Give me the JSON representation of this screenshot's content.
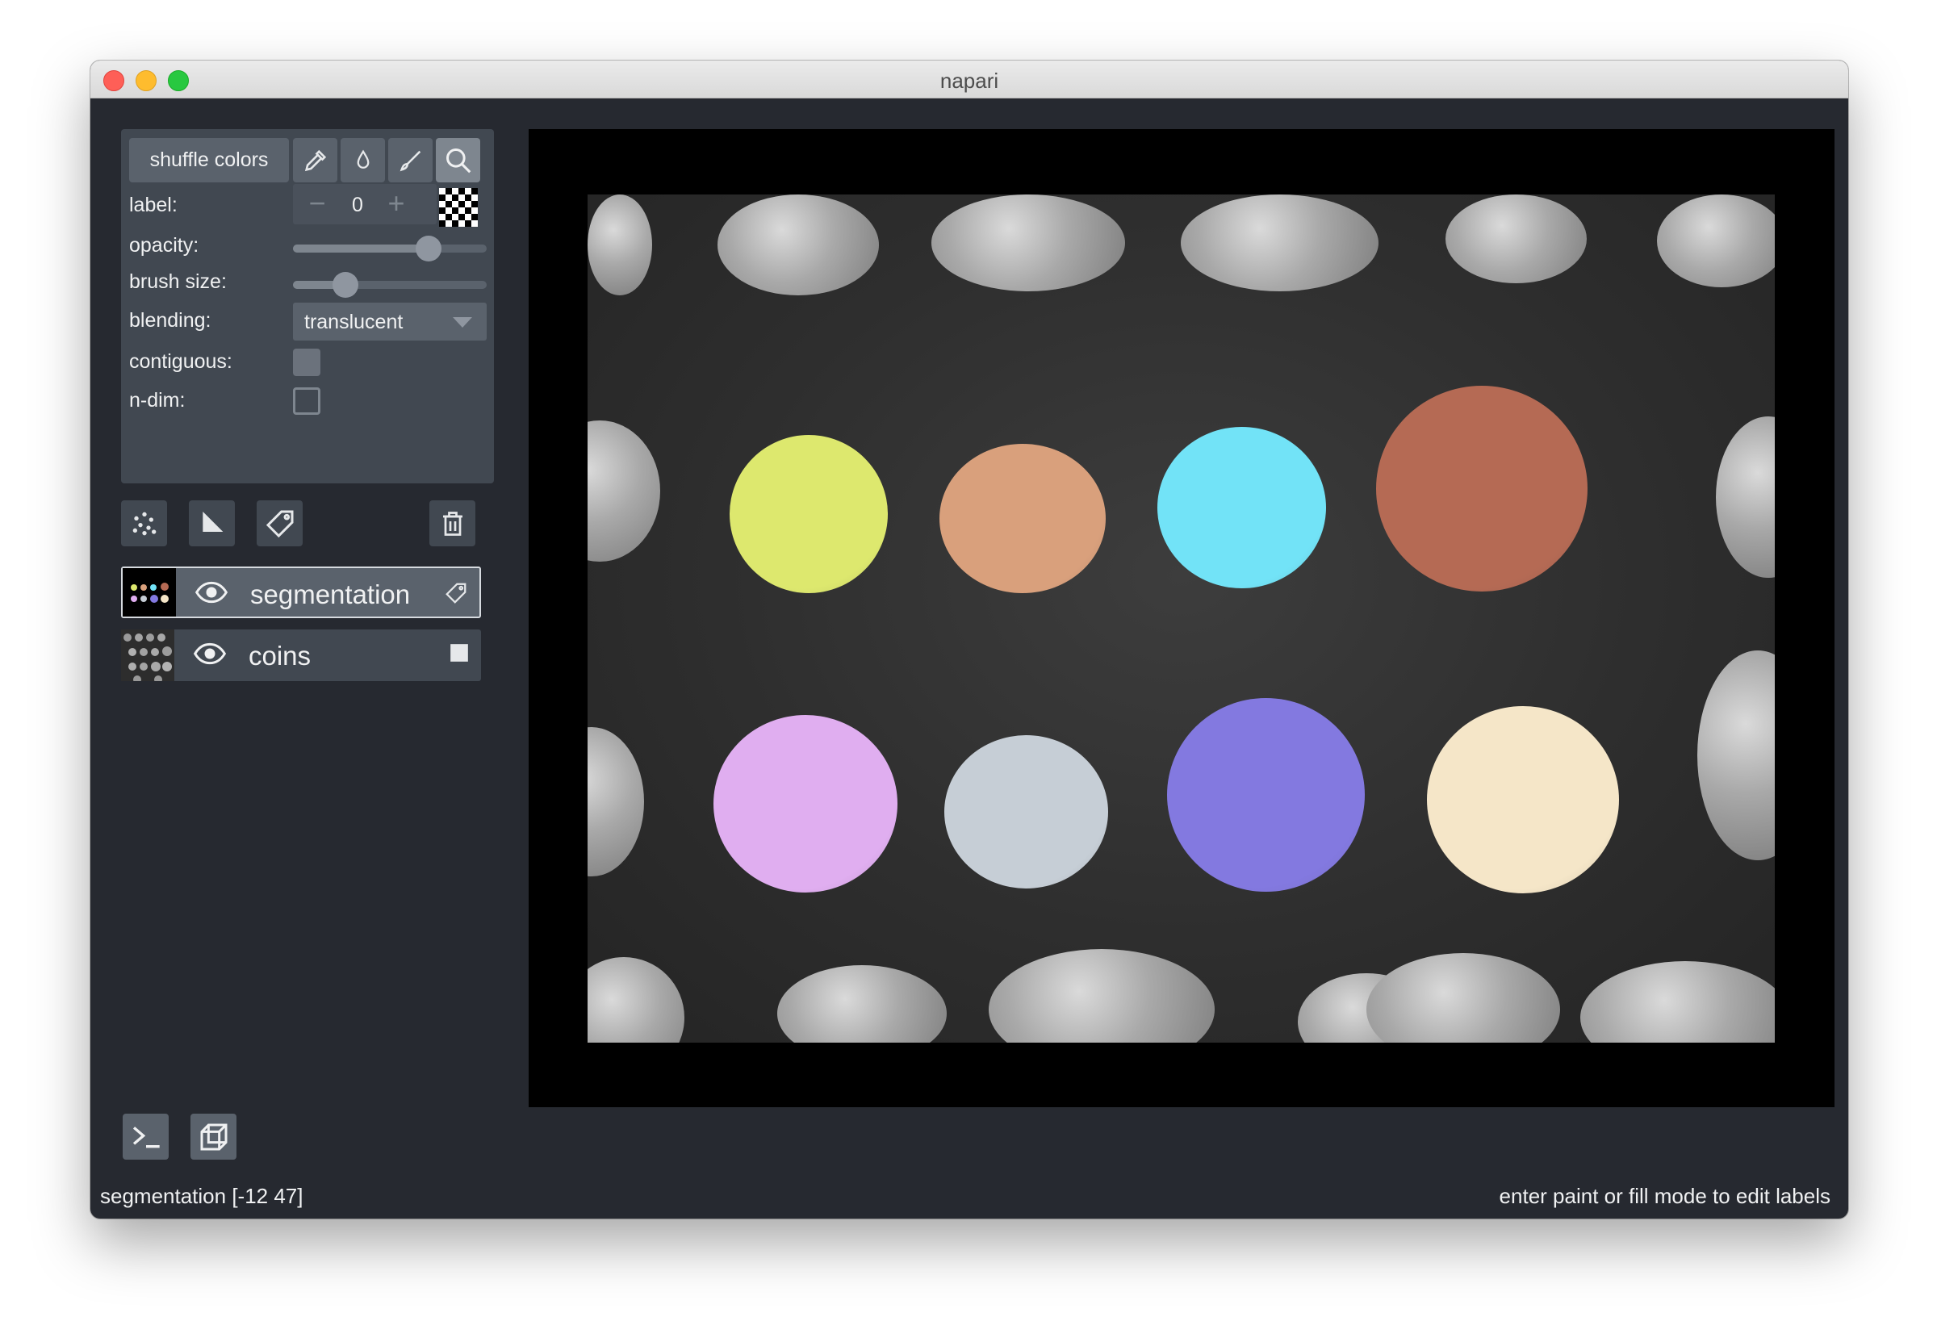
{
  "window": {
    "title": "napari"
  },
  "controls": {
    "shuffle_label": "shuffle colors",
    "tools": [
      "pick-mode",
      "fill-mode",
      "paint-mode",
      "pan-zoom-mode"
    ],
    "label_label": "label:",
    "label_value": "0",
    "minus": "−",
    "plus": "+",
    "opacity_label": "opacity:",
    "opacity_value": 0.7,
    "brush_label": "brush size:",
    "brush_value": 0.27,
    "blending_label": "blending:",
    "blending_value": "translucent",
    "contiguous_label": "contiguous:",
    "contiguous_checked": true,
    "ndim_label": "n-dim:",
    "ndim_checked": false
  },
  "layer_buttons": [
    "new-points",
    "new-shapes",
    "new-labels",
    "delete-layer"
  ],
  "layers": [
    {
      "name": "segmentation",
      "visible": true,
      "type": "labels",
      "selected": true
    },
    {
      "name": "coins",
      "visible": true,
      "type": "image",
      "selected": false
    }
  ],
  "bottom_buttons": [
    "console",
    "ndisplay-3d"
  ],
  "status": {
    "left": "segmentation [-12  47]",
    "right": "enter paint or fill mode to edit labels"
  },
  "colors": {
    "seg_colors": [
      "#dde86e",
      "#d9a07c",
      "#72e3f7",
      "#b56a54",
      "#e0aef0",
      "#c6ced6",
      "#8379e0",
      "#f5e6c8"
    ]
  }
}
